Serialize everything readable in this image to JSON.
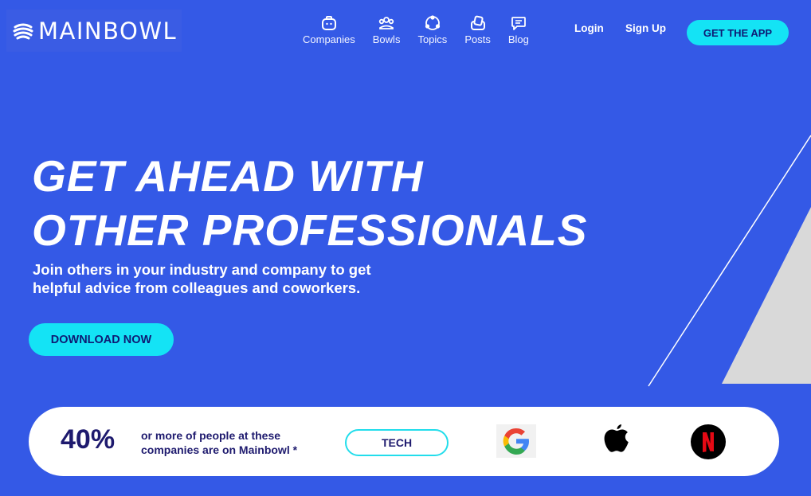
{
  "brand": {
    "name": "MAINBOWL"
  },
  "nav": {
    "items": [
      {
        "label": "Companies",
        "icon": "briefcase-icon"
      },
      {
        "label": "Bowls",
        "icon": "people-group-icon"
      },
      {
        "label": "Topics",
        "icon": "topics-hub-icon"
      },
      {
        "label": "Posts",
        "icon": "posts-icon"
      },
      {
        "label": "Blog",
        "icon": "chat-bubble-icon"
      }
    ],
    "login": "Login",
    "signup": "Sign Up",
    "cta": "GET THE APP"
  },
  "hero": {
    "title_line1": "GET AHEAD WITH",
    "title_line2": "OTHER PROFESSIONALS",
    "subtitle": "Join others in your industry and company to get helpful advice from colleagues and coworkers.",
    "cta": "DOWNLOAD NOW"
  },
  "stats": {
    "percent": "40%",
    "text": "or more of people at these companies are on Mainbowl *",
    "filter_label": "TECH",
    "company_logos": [
      "google-logo",
      "apple-logo",
      "netflix-logo"
    ]
  },
  "colors": {
    "background": "#3459E6",
    "accent": "#14E3F5",
    "dark_text": "#1E1A6E"
  }
}
